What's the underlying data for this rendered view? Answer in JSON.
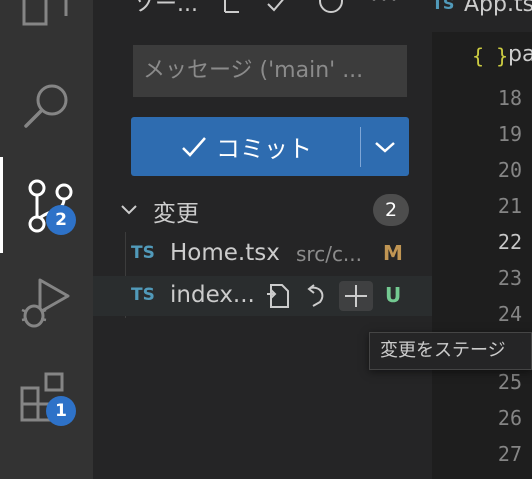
{
  "activity_bar": {
    "scm_badge": "2",
    "extensions_badge": "1"
  },
  "sidebar": {
    "title": "ソー...",
    "commit_message_placeholder": "メッセージ ('main' ...",
    "commit_label": "コミット",
    "changes_section": {
      "label": "変更",
      "count": "2"
    },
    "files": [
      {
        "type": "TS",
        "name": "Home.tsx",
        "path": "src/c...",
        "status": "M"
      },
      {
        "type": "TS",
        "name": "index...",
        "status": "U"
      }
    ]
  },
  "editor": {
    "tab_label": "App.tsx",
    "tab_type": "TS",
    "breadcrumb_brace": "{ }",
    "breadcrumb_label": "pa",
    "line_numbers": [
      "18",
      "19",
      "20",
      "21",
      "22",
      "23",
      "24",
      "25",
      "26",
      "27"
    ],
    "current_line": "22"
  },
  "tooltip": {
    "text": "変更をステージ"
  },
  "colors": {
    "activity_bar": "#333333",
    "sidebar": "#252526",
    "editor": "#1e1e1e",
    "accent_button": "#2e6cb0",
    "badge": "#2e72c8",
    "ts_icon": "#519aba",
    "modified": "#c09553",
    "untracked": "#73c991"
  }
}
